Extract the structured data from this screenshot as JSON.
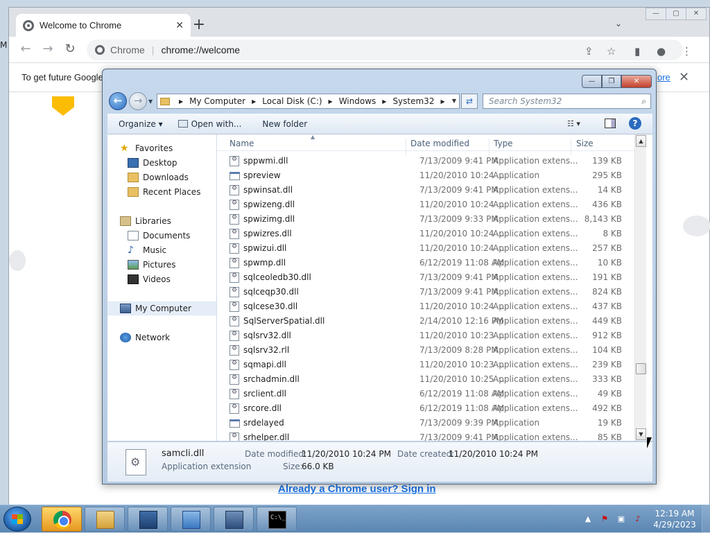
{
  "chrome": {
    "tab_title": "Welcome to Chrome",
    "tab_close": "✕",
    "new_tab": "+",
    "tab_search": "⌄",
    "win_min": "—",
    "win_max": "▢",
    "win_close": "✕",
    "back": "←",
    "forward": "→",
    "reload": "↻",
    "site_label": "Chrome",
    "url": "chrome://welcome",
    "infobar_text": "To get future Google",
    "infobar_link": "ore",
    "infobar_close": "✕",
    "signin_link": "Already a Chrome user? Sign in",
    "edge_text": "M"
  },
  "explorer": {
    "breadcrumbs": [
      "My Computer",
      "Local Disk (C:)",
      "Windows",
      "System32"
    ],
    "search_placeholder": "Search System32",
    "toolbar": {
      "organize": "Organize ▾",
      "open_with": "Open with...",
      "new_folder": "New folder"
    },
    "nav": {
      "favorites": "Favorites",
      "desktop": "Desktop",
      "downloads": "Downloads",
      "recent_places": "Recent Places",
      "libraries": "Libraries",
      "documents": "Documents",
      "music": "Music",
      "pictures": "Pictures",
      "videos": "Videos",
      "my_computer": "My Computer",
      "network": "Network"
    },
    "columns": {
      "name": "Name",
      "date": "Date modified",
      "type": "Type",
      "size": "Size"
    },
    "files": [
      {
        "name": "sppwmi.dll",
        "date": "7/13/2009 9:41 PM",
        "type": "Application extens...",
        "size": "139 KB",
        "icon": "dll"
      },
      {
        "name": "spreview",
        "date": "11/20/2010 10:24 ...",
        "type": "Application",
        "size": "295 KB",
        "icon": "app"
      },
      {
        "name": "spwinsat.dll",
        "date": "7/13/2009 9:41 PM",
        "type": "Application extens...",
        "size": "14 KB",
        "icon": "dll"
      },
      {
        "name": "spwizeng.dll",
        "date": "11/20/2010 10:24 ...",
        "type": "Application extens...",
        "size": "436 KB",
        "icon": "dll"
      },
      {
        "name": "spwizimg.dll",
        "date": "7/13/2009 9:33 PM",
        "type": "Application extens...",
        "size": "8,143 KB",
        "icon": "dll"
      },
      {
        "name": "spwizres.dll",
        "date": "11/20/2010 10:24 ...",
        "type": "Application extens...",
        "size": "8 KB",
        "icon": "dll"
      },
      {
        "name": "spwizui.dll",
        "date": "11/20/2010 10:24 ...",
        "type": "Application extens...",
        "size": "257 KB",
        "icon": "dll"
      },
      {
        "name": "spwmp.dll",
        "date": "6/12/2019 11:08 AM",
        "type": "Application extens...",
        "size": "10 KB",
        "icon": "dll"
      },
      {
        "name": "sqlceoledb30.dll",
        "date": "7/13/2009 9:41 PM",
        "type": "Application extens...",
        "size": "191 KB",
        "icon": "dll"
      },
      {
        "name": "sqlceqp30.dll",
        "date": "7/13/2009 9:41 PM",
        "type": "Application extens...",
        "size": "824 KB",
        "icon": "dll"
      },
      {
        "name": "sqlcese30.dll",
        "date": "11/20/2010 10:24 ...",
        "type": "Application extens...",
        "size": "437 KB",
        "icon": "dll"
      },
      {
        "name": "SqlServerSpatial.dll",
        "date": "2/14/2010 12:16 PM",
        "type": "Application extens...",
        "size": "449 KB",
        "icon": "dll"
      },
      {
        "name": "sqlsrv32.dll",
        "date": "11/20/2010 10:23 ...",
        "type": "Application extens...",
        "size": "912 KB",
        "icon": "dll"
      },
      {
        "name": "sqlsrv32.rll",
        "date": "7/13/2009 8:28 PM",
        "type": "Application extens...",
        "size": "104 KB",
        "icon": "dll"
      },
      {
        "name": "sqmapi.dll",
        "date": "11/20/2010 10:23 ...",
        "type": "Application extens...",
        "size": "239 KB",
        "icon": "dll"
      },
      {
        "name": "srchadmin.dll",
        "date": "11/20/2010 10:25 ...",
        "type": "Application extens...",
        "size": "333 KB",
        "icon": "dll"
      },
      {
        "name": "srclient.dll",
        "date": "6/12/2019 11:08 AM",
        "type": "Application extens...",
        "size": "49 KB",
        "icon": "dll"
      },
      {
        "name": "srcore.dll",
        "date": "6/12/2019 11:08 AM",
        "type": "Application extens...",
        "size": "492 KB",
        "icon": "dll"
      },
      {
        "name": "srdelayed",
        "date": "7/13/2009 9:39 PM",
        "type": "Application",
        "size": "19 KB",
        "icon": "app"
      },
      {
        "name": "srhelper.dll",
        "date": "7/13/2009 9:41 PM",
        "type": "Application extens...",
        "size": "85 KB",
        "icon": "dll"
      }
    ],
    "details": {
      "file_name": "samcli.dll",
      "file_type": "Application extension",
      "modified_label": "Date modified:",
      "modified_value": "11/20/2010 10:24 PM",
      "created_label": "Date created:",
      "created_value": "11/20/2010 10:24 PM",
      "size_label": "Size:",
      "size_value": "66.0 KB"
    }
  },
  "taskbar": {
    "time": "12:19 AM",
    "date": "4/29/2023",
    "cmd_glyph": "C:\\_"
  },
  "colors": {
    "chrome_blue": "#1a73e8",
    "win7_taskbar": "#5b86b3",
    "selection": "#e5eef8"
  }
}
